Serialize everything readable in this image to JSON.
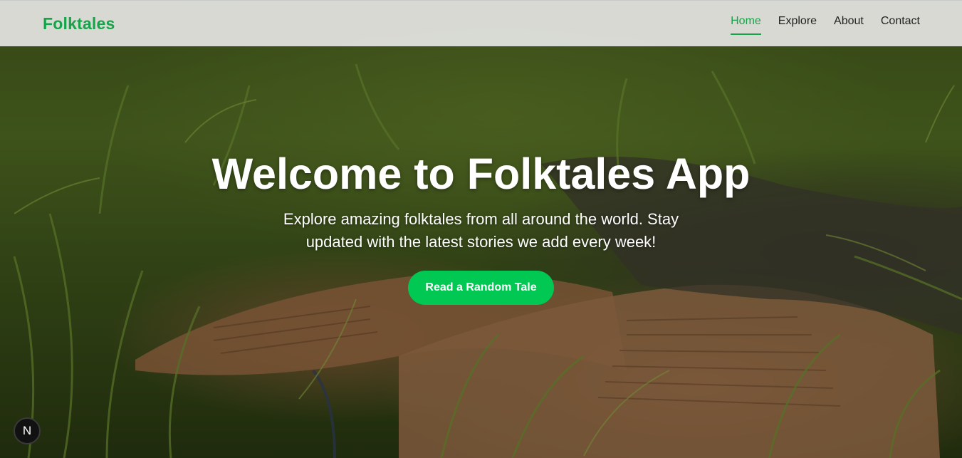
{
  "brand": {
    "name": "Folktales",
    "accent": "#16a34a"
  },
  "nav": {
    "items": [
      {
        "label": "Home",
        "active": true
      },
      {
        "label": "Explore",
        "active": false
      },
      {
        "label": "About",
        "active": false
      },
      {
        "label": "Contact",
        "active": false
      }
    ]
  },
  "hero": {
    "title": "Welcome to Folktales App",
    "subtitle": "Explore amazing folktales from all around the world. Stay updated with the latest stories we add every week!",
    "cta_label": "Read a Random Tale",
    "cta_color": "#00c853"
  },
  "dev_badge": {
    "label": "N"
  }
}
